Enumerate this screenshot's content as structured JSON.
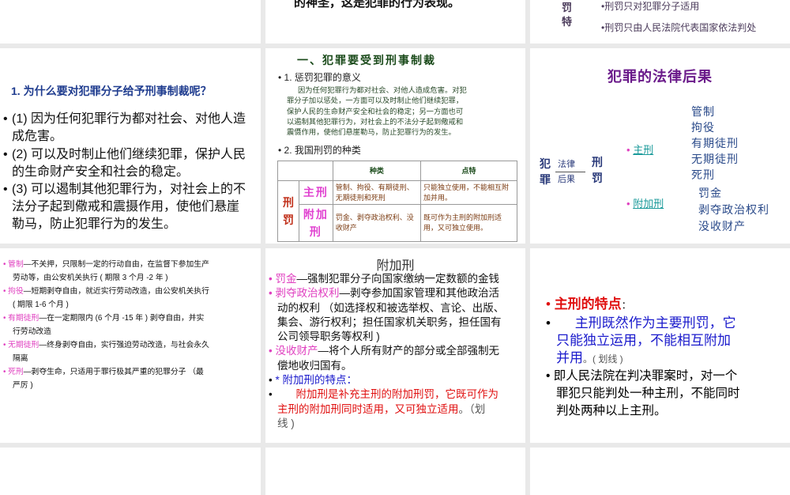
{
  "slides": {
    "top_middle": {
      "partial_text": "的神圣，这是犯罪的行为表现。"
    },
    "top_right": {
      "side_label": [
        "罚",
        "特"
      ],
      "bullets": [
        "•刑罚只对犯罪分子适用",
        "•刑罚只由人民法院代表国家依法判处"
      ]
    },
    "why": {
      "title": "1. 为什么要对犯罪分子给予刑事制裁呢？",
      "bullets": [
        [
          "(1) 因为任何犯罪行为都对社会、对他人造",
          "成危害。"
        ],
        [
          "(2) 可以及时制止他们继续犯罪，保护人民",
          "的生命财产安全和社会的稳定。"
        ],
        [
          "(3) 可以遏制其他犯罪行为，对社会上的不",
          "法分子起到儆戒和震摄作用，使他们悬崖",
          "勒马，防止犯罪行为的发生。"
        ]
      ]
    },
    "sanction": {
      "title": "一、犯罪要受到刑事制裁",
      "h1": "1. 惩罚犯罪的意义",
      "para": [
        "因为任何犯罪行为都对社会、对他人造成危害。对犯",
        "罪分子加以惩处，一方面可以及时制止他们继续犯罪，",
        "保护人民的生命财产安全和社会的稳定；另一方面也可",
        "以遏制其他犯罪行为，对社会上的不法分子起到儆戒和",
        "震慑作用，使他们悬崖勒马，防止犯罪行为的发生。"
      ],
      "h2": "2. 我国刑罚的种类",
      "table": {
        "head": [
          "种类",
          "点特"
        ],
        "group": "刑罚",
        "rows": [
          {
            "name": "主刑",
            "kinds": "管制、拘役、有期徒刑、无期徒刑和死刑",
            "feature": "只能独立使用，不能相互附加并用。"
          },
          {
            "name": "附加刑",
            "kinds": "罚金、剥夺政治权利、没收财产",
            "feature": "既可作为主刑的附加刑适用，又可独立使用。"
          }
        ]
      }
    },
    "consequence": {
      "title": "犯罪的法律后果",
      "left": "犯罪",
      "arrow_label": [
        "法律",
        "后果"
      ],
      "mid": "刑罚",
      "main_link": "主刑",
      "main_items": [
        "管制",
        "拘役",
        "有期徒刑",
        "无期徒刑",
        "死刑"
      ],
      "add_link": "附加刑",
      "add_items": [
        "罚金",
        "剥夺政治权利",
        "没收财产"
      ]
    },
    "main_list": {
      "items": [
        {
          "term": "管制",
          "text": "—不关押，只限制一定的行动自由，在监督下参加生产",
          "cont": "劳动等，由公安机关执行 ( 期限 3 个月 -2 年 )"
        },
        {
          "term": "拘役",
          "text": "—短期剥夺自由，就近实行劳动改造，由公安机关执行",
          "cont": "( 期限 1-6 个月 )"
        },
        {
          "term": "有期徒刑",
          "text": "—在一定期限内 (6  个月 -15 年 ) 剥夺自由，并实",
          "cont": "行劳动改造"
        },
        {
          "term": "无期徒刑",
          "text": "—终身剥夺自由，实行强迫劳动改造，与社会永久",
          "cont": "隔离"
        },
        {
          "term": "死刑",
          "text": "—剥夺生命，只适用于罪行极其严重的犯罪分子   （最",
          "cont": "严厉 )"
        }
      ]
    },
    "additional": {
      "title": "附加刑",
      "items": [
        {
          "term": "罚金",
          "lines": [
            "—强制犯罪分子向国家缴纳一定数额的金钱"
          ]
        },
        {
          "term": "剥夺政治权利",
          "lines": [
            "—剥夺参加国家管理和其他政治活",
            "动的权利 （如选择权和被选举权、言论、出版、",
            "集会、游行权利；担任国家机关职务，担任国有",
            "公司领导职务等权利 )"
          ]
        },
        {
          "term": "没收财产",
          "lines": [
            "—将个人所有财产的部分或全部强制无",
            "偿地收归国有。"
          ]
        }
      ],
      "feature_label": "* 附加刑的特点：",
      "feature_text": [
        "附加刑是补充主刑的附加刑罚，它既可作为",
        "主刑的附加刑同时适用，又可独立适用"
      ],
      "feature_tail": "。（划",
      "feature_tail2": "线 )"
    },
    "main_feature": {
      "title": "主刑的特点",
      "colon": "：",
      "blue": [
        "主刑既然作为主要刑罚，它",
        "只能独立运用，不能相互附加",
        "并用"
      ],
      "note": "。( 划线 )",
      "black": [
        "即人民法院在判决罪案时，对一个",
        "罪犯只能判处一种主刑，不能同时",
        "判处两种以上主刑。"
      ]
    }
  }
}
